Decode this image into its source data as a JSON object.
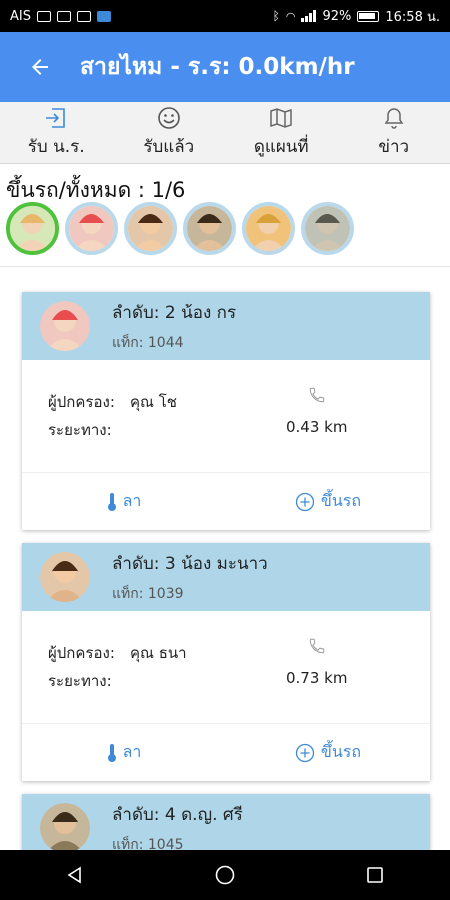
{
  "status_bar": {
    "carrier": "AIS",
    "battery": "92%",
    "time": "16:58 น."
  },
  "app_bar": {
    "back_icon": "arrow-back-icon",
    "title": "สายไหม - ร.ร: 0.0km/hr"
  },
  "tabs": [
    {
      "label": "รับ น.ร.",
      "icon": "login-icon"
    },
    {
      "label": "รับแล้ว",
      "icon": "smiley-icon"
    },
    {
      "label": "ดูแผนที่",
      "icon": "map-icon"
    },
    {
      "label": "ข่าว",
      "icon": "bell-icon"
    }
  ],
  "pickup_count": "ขึ้นรถ/ทั้งหมด : 1/6",
  "avatars": [
    {
      "name": "student-1",
      "bg": "#d6e7b8",
      "face": "#f3d3b5",
      "hair": "#e8b86a",
      "active": true
    },
    {
      "name": "student-2",
      "bg": "#f0c8c0",
      "face": "#f5d6c0",
      "hair": "#e84e4e",
      "active": false
    },
    {
      "name": "student-3",
      "bg": "#e3c7a8",
      "face": "#f2cba2",
      "hair": "#4a2a14",
      "active": false
    },
    {
      "name": "student-4",
      "bg": "#c7b79a",
      "face": "#e3c09a",
      "hair": "#3a2a1a",
      "active": false
    },
    {
      "name": "student-5",
      "bg": "#f0c27a",
      "face": "#f1d0ad",
      "hair": "#d9a13a",
      "active": false
    },
    {
      "name": "student-6",
      "bg": "#bfc2b4",
      "face": "#cfc5b0",
      "hair": "#5a574f",
      "active": false
    }
  ],
  "labels": {
    "guardian": "ผู้ปกครอง:",
    "distance": "ระยะทาง:",
    "leave": "ลา",
    "board": "ขึ้นรถ"
  },
  "colors": {
    "app_bar": "#4a8ef0",
    "card_header": "#aed6e8",
    "accent_blue": "#3f8ad8",
    "active_ring": "#4ec23a"
  },
  "students": [
    {
      "order": "ลำดับ: 2 น้อง กร",
      "tag": "แท็ก: 1044",
      "guardian": "คุณ โช",
      "distance": "0.43 km",
      "avatar_bg": "#f0c8c0",
      "avatar_face": "#f5d6c0",
      "avatar_hair": "#e84e4e"
    },
    {
      "order": "ลำดับ: 3 น้อง มะนาว",
      "tag": "แท็ก: 1039",
      "guardian": "คุณ ธนา",
      "distance": "0.73 km",
      "avatar_bg": "#e3c7a8",
      "avatar_face": "#f2cba2",
      "avatar_hair": "#4a2a14"
    },
    {
      "order": "ลำดับ: 4 ด.ญ. ศรี",
      "tag": "แท็ก: 1045",
      "guardian": "",
      "distance": "",
      "avatar_bg": "#c7b79a",
      "avatar_face": "#e3c09a",
      "avatar_hair": "#3a2a1a"
    }
  ]
}
